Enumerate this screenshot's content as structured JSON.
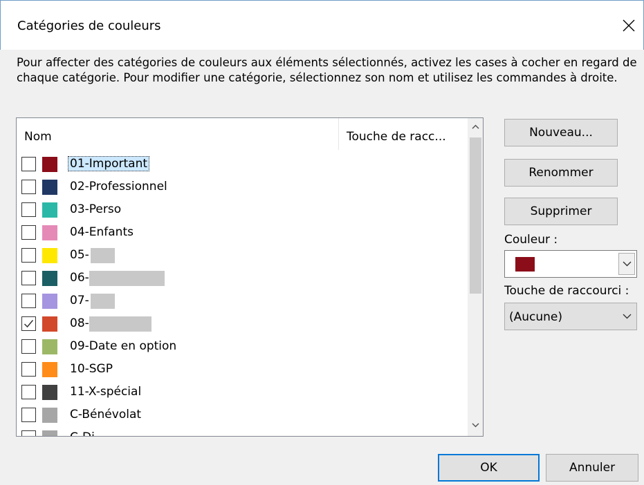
{
  "window": {
    "title": "Catégories de couleurs",
    "close_icon": "close-icon"
  },
  "instructions": "Pour affecter des catégories de couleurs aux éléments sélectionnés, activez les cases à cocher en regard de chaque catégorie. Pour modifier une catégorie, sélectionnez son nom et utilisez les commandes à droite.",
  "list": {
    "columns": {
      "name": "Nom",
      "shortcut": "Touche de racc..."
    },
    "items": [
      {
        "label": "01-Important",
        "color": "#8b0d1a",
        "checked": false,
        "selected": true
      },
      {
        "label": "02-Professionnel",
        "color": "#203864",
        "checked": false
      },
      {
        "label": "03-Perso",
        "color": "#2bb8a6",
        "checked": false
      },
      {
        "label": "04-Enfants",
        "color": "#e58ab7",
        "checked": false
      },
      {
        "label": "05-",
        "color": "#ffe800",
        "checked": false,
        "redacted": true
      },
      {
        "label": "06-",
        "color": "#1b5e63",
        "checked": false,
        "redacted": true
      },
      {
        "label": "07-",
        "color": "#a594e0",
        "checked": false,
        "redacted": true
      },
      {
        "label": "08-",
        "color": "#d2482b",
        "checked": true,
        "redacted": true
      },
      {
        "label": "09-Date en option",
        "color": "#9cb866",
        "checked": false
      },
      {
        "label": "10-SGP",
        "color": "#ff8c19",
        "checked": false
      },
      {
        "label": "11-X-spécial",
        "color": "#404040",
        "checked": false
      },
      {
        "label": "C-Bénévolat",
        "color": "#a6a6a6",
        "checked": false
      },
      {
        "label": "C-Di...",
        "color": "#a6a6a6",
        "checked": false
      }
    ]
  },
  "buttons": {
    "new": "Nouveau...",
    "rename": "Renommer",
    "delete": "Supprimer",
    "ok": "OK",
    "cancel": "Annuler"
  },
  "color_field": {
    "label": "Couleur :",
    "value_color": "#8b0d1a"
  },
  "shortcut_field": {
    "label": "Touche de raccourci :",
    "value": "(Aucune)"
  }
}
